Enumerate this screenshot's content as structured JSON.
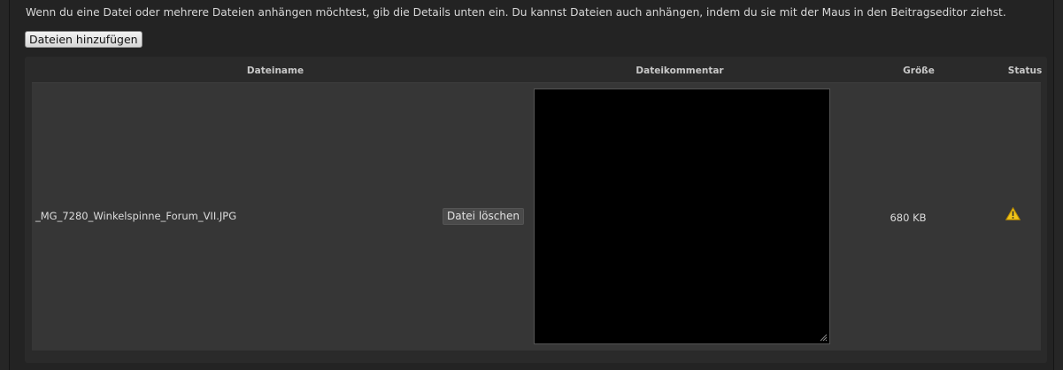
{
  "upload": {
    "intro_text": "Wenn du eine Datei oder mehrere Dateien anhängen möchtest, gib die Details unten ein. Du kannst Dateien auch anhängen, indem du sie mit der Maus in den Beitragseditor ziehst.",
    "add_files_label": "Dateien hinzufügen"
  },
  "table": {
    "headers": {
      "filename": "Dateiname",
      "comment": "Dateikommentar",
      "size": "Größe",
      "status": "Status"
    },
    "rows": [
      {
        "filename": "_MG_7280_Winkelspinne_Forum_VII.JPG",
        "delete_label": "Datei löschen",
        "comment": "",
        "size": "680 KB",
        "status_icon": "warning-icon"
      }
    ]
  },
  "colors": {
    "warning": "#e8b800"
  }
}
